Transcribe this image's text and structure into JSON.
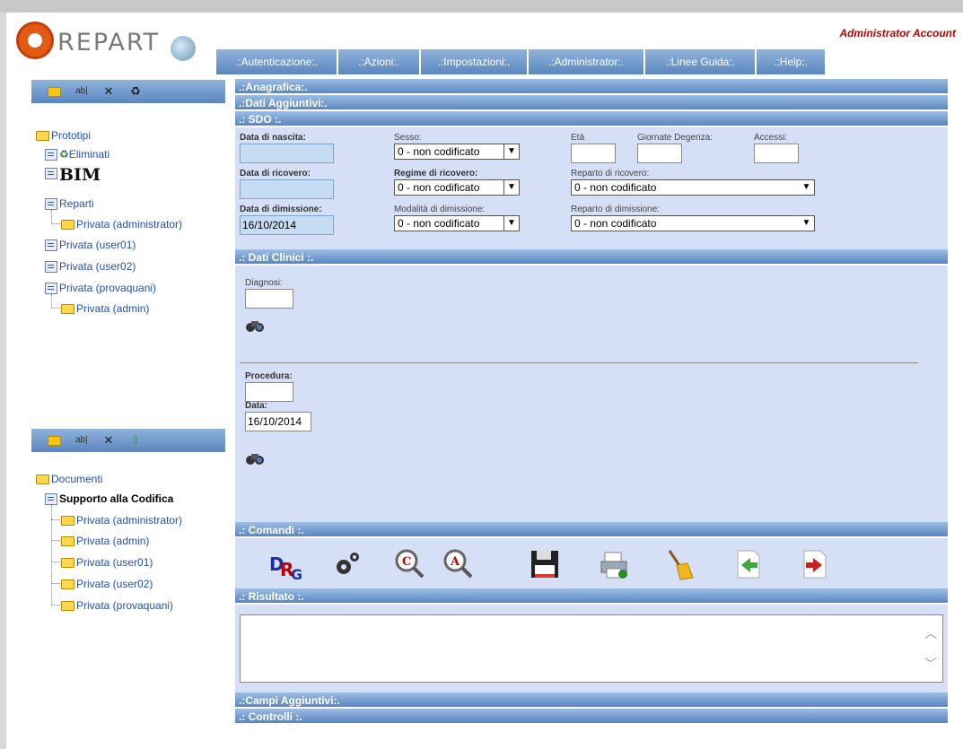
{
  "app": {
    "logo_text": "REPART",
    "account_label": "Administrator Account"
  },
  "menu": [
    {
      "label": ".:Autenticazione:."
    },
    {
      "label": ".:Azioni:."
    },
    {
      "label": ".:Impostazioni:."
    },
    {
      "label": ".:Administrator:."
    },
    {
      "label": ".:Linee Guida:."
    },
    {
      "label": ".:Help:."
    }
  ],
  "tree1": {
    "root": "Prototipi",
    "eliminati": "Eliminati",
    "bim": "BIM",
    "reparti": "Reparti",
    "privata_administrator": "Privata (administrator)",
    "privata_user01": "Privata (user01)",
    "privata_user02": "Privata (user02)",
    "privata_provaquani": "Privata (provaquani)",
    "privata_admin": "Privata (admin)"
  },
  "tree2": {
    "root": "Documenti",
    "supporto": "Supporto alla Codifica",
    "children": [
      "Privata (administrator)",
      "Privata (admin)",
      "Privata (user01)",
      "Privata (user02)",
      "Privata (provaquani)"
    ]
  },
  "sections": {
    "anagrafica": ".:Anagrafica:.",
    "dati_aggiuntivi": ".:Dati Aggiuntivi:.",
    "sdo": ".: SDO :.",
    "dati_clinici": ".: Dati Clinici :.",
    "comandi": ".: Comandi :.",
    "risultato": ".: Risultato :.",
    "campi_aggiuntivi": ".:Campi Aggiuntivi:.",
    "controlli": ".: Controlli :."
  },
  "sdo": {
    "data_nascita_label": "Data di nascita:",
    "data_nascita_value": "",
    "sesso_label": "Sesso:",
    "sesso_value": "0 - non codificato",
    "eta_label": "Età",
    "giornate_label": "Giornate Degenza:",
    "accessi_label": "Accessi:",
    "data_ricovero_label": "Data di ricovero:",
    "regime_label": "Regime di ricovero:",
    "regime_value": "0 - non codificato",
    "reparto_ricovero_label": "Reparto di ricovero:",
    "reparto_ricovero_value": "0 - non codificato",
    "data_dimissione_label": "Data di dimissione:",
    "data_dimissione_value": "16/10/2014",
    "modalita_label": "Modalità di dimissione:",
    "modalita_value": "0 - non codificato",
    "reparto_dimissione_label": "Reparto di dimissione:",
    "reparto_dimissione_value": "0 - non codificato"
  },
  "clinici": {
    "diagnosi_label": "Diagnosi:",
    "procedura_label": "Procedura:",
    "data_label": "Data:",
    "data_value": "16/10/2014"
  },
  "colors": {
    "accent": "#5b86bf",
    "panel": "#d5dff5",
    "account_red": "#c00000"
  }
}
